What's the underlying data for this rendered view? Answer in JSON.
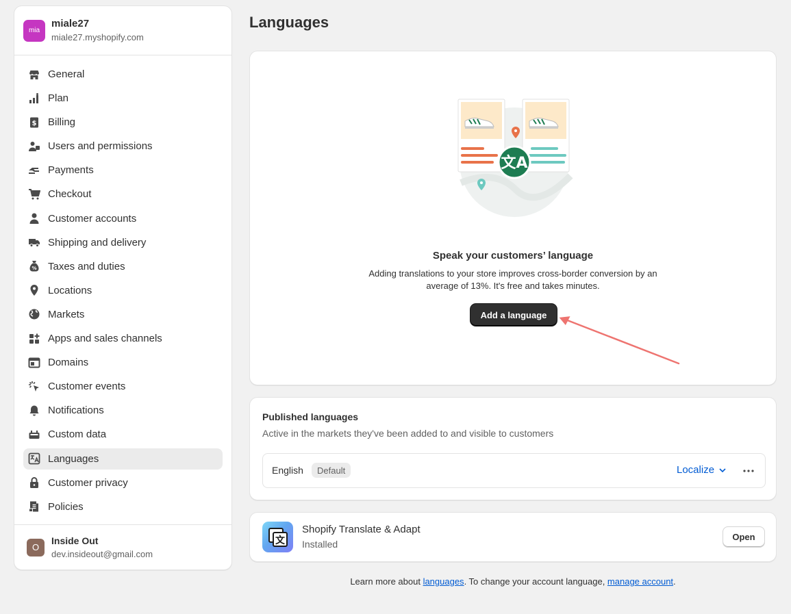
{
  "store": {
    "avatar_text": "mia",
    "name": "miale27",
    "domain": "miale27.myshopify.com"
  },
  "nav": [
    {
      "label": "General",
      "icon": "store-icon"
    },
    {
      "label": "Plan",
      "icon": "plan-icon"
    },
    {
      "label": "Billing",
      "icon": "billing-icon"
    },
    {
      "label": "Users and permissions",
      "icon": "users-icon"
    },
    {
      "label": "Payments",
      "icon": "payments-icon"
    },
    {
      "label": "Checkout",
      "icon": "cart-icon"
    },
    {
      "label": "Customer accounts",
      "icon": "person-icon"
    },
    {
      "label": "Shipping and delivery",
      "icon": "truck-icon"
    },
    {
      "label": "Taxes and duties",
      "icon": "tax-icon"
    },
    {
      "label": "Locations",
      "icon": "location-icon"
    },
    {
      "label": "Markets",
      "icon": "globe-icon"
    },
    {
      "label": "Apps and sales channels",
      "icon": "apps-icon"
    },
    {
      "label": "Domains",
      "icon": "domain-icon"
    },
    {
      "label": "Customer events",
      "icon": "cursor-icon"
    },
    {
      "label": "Notifications",
      "icon": "bell-icon"
    },
    {
      "label": "Custom data",
      "icon": "data-icon"
    },
    {
      "label": "Languages",
      "icon": "language-icon",
      "active": true
    },
    {
      "label": "Customer privacy",
      "icon": "lock-icon"
    },
    {
      "label": "Policies",
      "icon": "policy-icon"
    }
  ],
  "account": {
    "avatar_text": "O",
    "name": "Inside Out",
    "email": "dev.insideout@gmail.com"
  },
  "page": {
    "title": "Languages"
  },
  "hero": {
    "title": "Speak your customers’ language",
    "description": "Adding translations to your store improves cross-border conversion by an average of 13%. It's free and takes minutes.",
    "button_label": "Add a language"
  },
  "published": {
    "title": "Published languages",
    "subtitle": "Active in the markets they've been added to and visible to customers",
    "language": "English",
    "badge": "Default",
    "localize_label": "Localize"
  },
  "app": {
    "name": "Shopify Translate & Adapt",
    "status": "Installed",
    "button_label": "Open"
  },
  "footer": {
    "prefix": "Learn more about ",
    "link1": "languages",
    "middle": ". To change your account language, ",
    "link2": "manage account",
    "suffix": "."
  },
  "colors": {
    "accent_link": "#005bd3",
    "primary_button": "#303030",
    "arrow": "#ee7470",
    "store_avatar": "#c536c1"
  }
}
